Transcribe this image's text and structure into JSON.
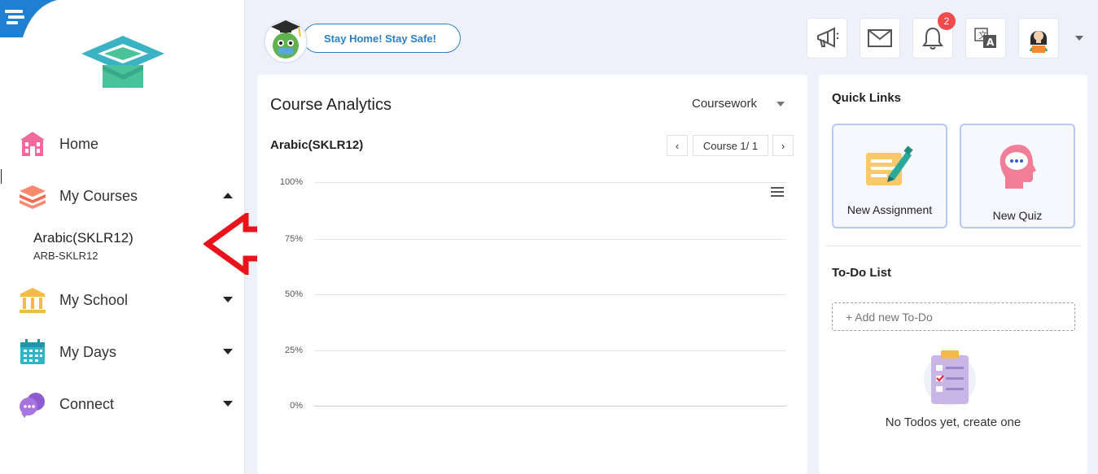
{
  "sidebar": {
    "items": [
      {
        "label": "Home",
        "icon": "school-building-icon"
      },
      {
        "label": "My Courses",
        "icon": "books-stack-icon"
      },
      {
        "label": "My School",
        "icon": "institution-icon"
      },
      {
        "label": "My Days",
        "icon": "calendar-icon"
      },
      {
        "label": "Connect",
        "icon": "chat-bubbles-icon"
      }
    ],
    "active_course": {
      "name": "Arabic(SKLR12)",
      "code": "ARB-SKLR12"
    }
  },
  "header": {
    "banner": "Stay Home! Stay Safe!",
    "notification_count": "2",
    "icons": [
      "megaphone-icon",
      "mail-icon",
      "bell-icon",
      "translate-icon",
      "user-avatar-icon"
    ]
  },
  "analytics": {
    "title": "Course Analytics",
    "filter": "Coursework",
    "course_name": "Arabic(SKLR12)",
    "pager": {
      "label": "Course 1/ 1",
      "prev": "‹",
      "next": "›"
    },
    "y_ticks": [
      "100%",
      "75%",
      "50%",
      "25%",
      "0%"
    ]
  },
  "chart_data": {
    "type": "bar",
    "title": "",
    "categories": [],
    "values": [],
    "ylim": [
      0,
      100
    ],
    "yticks": [
      "100%",
      "75%",
      "50%",
      "25%",
      "0%"
    ],
    "grid": true
  },
  "quick_links": {
    "title": "Quick Links",
    "tiles": [
      {
        "label": "New Assignment"
      },
      {
        "label": "New Quiz"
      }
    ]
  },
  "todo": {
    "title": "To-Do List",
    "placeholder": "+ Add new To-Do",
    "empty_text": "No Todos yet, create one"
  },
  "colors": {
    "accent_blue": "#2d7fc1",
    "badge_red": "#f04a4a",
    "annotation_red": "#e8131b"
  }
}
